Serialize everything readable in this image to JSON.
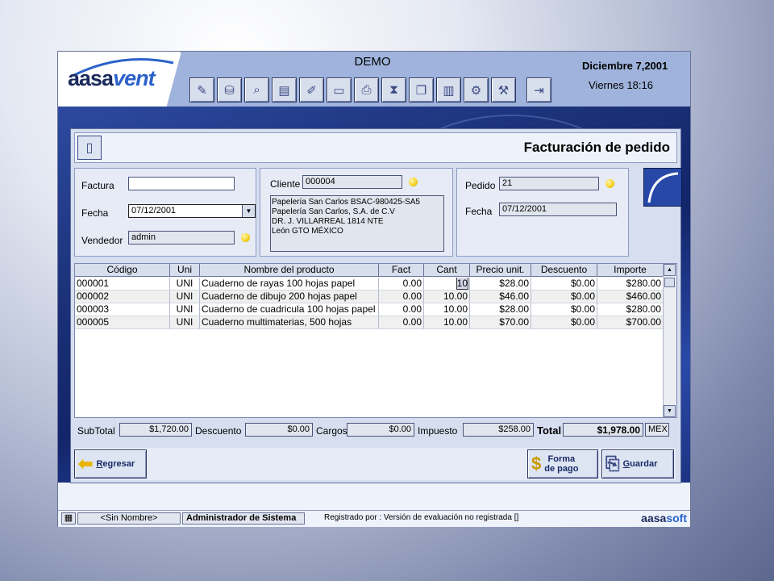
{
  "header": {
    "app_title": "DEMO",
    "date": "Diciembre 7,2001",
    "time": "Viernes  18:16",
    "logo_part1": "aasa",
    "logo_part2": "vent",
    "toolbar": [
      "pedido-icon",
      "inventario-icon",
      "consulta-icon",
      "documento-icon",
      "edicion-icon",
      "credito-icon",
      "caja-icon",
      "reloj-icon",
      "copias-icon",
      "libros-icon",
      "engranes-icon",
      "herramientas-icon",
      "salir-icon"
    ]
  },
  "form": {
    "title": "Facturación de pedido",
    "factura_label": "Factura",
    "factura_value": "",
    "fecha_label": "Fecha",
    "fecha_value": "07/12/2001",
    "vendedor_label": "Vendedor",
    "vendedor_value": "admin",
    "cliente_label": "Cliente",
    "cliente_value": "000004",
    "cliente_address": [
      "Papelería San Carlos BSAC-980425-SA5",
      "Papelería San Carlos, S.A. de C.V",
      "DR. J. VILLARREAL 1814 NTE",
      "León GTO MÉXICO"
    ],
    "pedido_label": "Pedido",
    "pedido_value": "21",
    "pedido_fecha_label": "Fecha",
    "pedido_fecha_value": "07/12/2001"
  },
  "grid": {
    "columns": [
      "Código",
      "Uni",
      "Nombre del producto",
      "Fact",
      "Cant",
      "Precio unit.",
      "Descuento",
      "Importe"
    ],
    "rows": [
      [
        "000001",
        "UNI",
        "Cuaderno de rayas 100 hojas papel",
        "0.00",
        "10",
        "$28.00",
        "$0.00",
        "$280.00"
      ],
      [
        "000002",
        "UNI",
        "Cuaderno de dibujo 200 hojas papel",
        "0.00",
        "10.00",
        "$46.00",
        "$0.00",
        "$460.00"
      ],
      [
        "000003",
        "UNI",
        "Cuaderno de cuadricula 100 hojas papel",
        "0.00",
        "10.00",
        "$28.00",
        "$0.00",
        "$280.00"
      ],
      [
        "000005",
        "UNI",
        "Cuaderno multimaterias, 500 hojas",
        "0.00",
        "10.00",
        "$70.00",
        "$0.00",
        "$700.00"
      ]
    ]
  },
  "totals": {
    "subtotal_label": "SubTotal",
    "subtotal": "$1,720.00",
    "descuento_label": "Descuento",
    "descuento": "$0.00",
    "cargos_label": "Cargos",
    "cargos": "$0.00",
    "impuesto_label": "Impuesto",
    "impuesto": "$258.00",
    "total_label": "Total",
    "total": "$1,978.00",
    "currency": "MEX"
  },
  "buttons": {
    "regresar_key": "R",
    "regresar_rest": "egresar",
    "forma_line1": "Forma",
    "forma_line2": "de pago",
    "guardar_key": "G",
    "guardar_rest": "uardar"
  },
  "status": {
    "name": "<Sin Nombre>",
    "user": "Administrador de Sistema",
    "registro": "Registrado por : Versión de evaluación no registrada  []",
    "brand1": "aasa",
    "brand2": "soft"
  },
  "colors": {
    "accent": "#2b62c9",
    "band": "#1a2f75",
    "panel": "#d6deef"
  }
}
